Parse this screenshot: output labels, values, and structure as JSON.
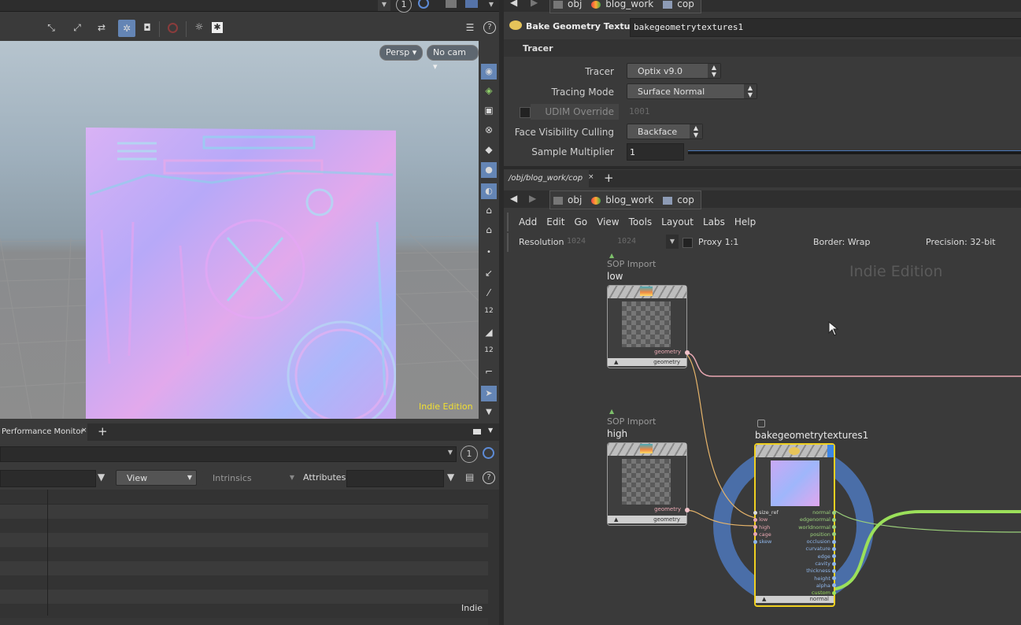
{
  "viewport": {
    "persp_label": "Persp ▾",
    "cam_label": "No cam ▾",
    "watermark": "Indie Edition",
    "top_counter": "1"
  },
  "bottom_panel": {
    "tab_label": "Performance Monitor",
    "counter": "1",
    "view_label": "View",
    "intrinsics_label": "Intrinsics",
    "attributes_label": "Attributes:",
    "status": "Indie"
  },
  "parameters": {
    "crumbs": [
      "obj",
      "blog_work",
      "cop"
    ],
    "node_type": "Bake Geometry Textures",
    "node_name": "bakegeometrytextures1",
    "section": "Tracer",
    "tracer_label": "Tracer",
    "tracer_value": "Optix v9.0",
    "tracing_mode_label": "Tracing Mode",
    "tracing_mode_value": "Surface Normal",
    "udim_label": "UDIM Override",
    "udim_value": "1001",
    "culling_label": "Face Visibility Culling",
    "culling_value": "Backface",
    "sample_label": "Sample Multiplier",
    "sample_value": "1"
  },
  "network": {
    "tab_path": "/obj/blog_work/cop",
    "crumbs": [
      "obj",
      "blog_work",
      "cop"
    ],
    "menu": [
      "Add",
      "Edit",
      "Go",
      "View",
      "Tools",
      "Layout",
      "Labs",
      "Help"
    ],
    "resolution_label": "Resolution",
    "res_x": "1024",
    "res_y": "1024",
    "proxy_label": "Proxy 1:1",
    "border_label": "Border: Wrap",
    "precision_label": "Precision: 32-bit",
    "watermark": "Indie Edition",
    "nodes": {
      "low": {
        "type": "SOP Import",
        "name": "low",
        "out_port": "geometry",
        "footer": "geometry"
      },
      "high": {
        "type": "SOP Import",
        "name": "high",
        "out_port": "geometry",
        "footer": "geometry"
      },
      "bake": {
        "name": "bakegeometrytextures1",
        "inputs": [
          "size_ref",
          "low",
          "high",
          "cage",
          "skew"
        ],
        "outputs": [
          "normal",
          "edgenormal",
          "worldnormal",
          "position",
          "occlusion",
          "curvature",
          "edge",
          "cavity",
          "thickness",
          "height",
          "alpha",
          "custom"
        ],
        "footer": "normal"
      }
    }
  },
  "colors": {
    "accent_yellow": "#f0d020",
    "wire_green": "#9be05a",
    "wire_pink": "#e9a8b2",
    "ring_blue": "#4a6ea8"
  }
}
